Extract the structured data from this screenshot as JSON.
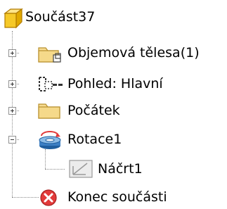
{
  "tree": {
    "root": {
      "label": "Součást37",
      "icon": "part-icon"
    },
    "items": [
      {
        "label": "Objemová tělesa(1)",
        "icon": "solid-bodies-folder-icon",
        "expanded": false
      },
      {
        "label": "Pohled: Hlavní",
        "icon": "view-icon",
        "expanded": false
      },
      {
        "label": "Počátek",
        "icon": "origin-folder-icon",
        "expanded": false
      },
      {
        "label": "Rotace1",
        "icon": "revolve-feature-icon",
        "expanded": true,
        "children": [
          {
            "label": "Náčrt1",
            "icon": "sketch-icon"
          }
        ]
      },
      {
        "label": "Konec součásti",
        "icon": "end-of-part-icon"
      }
    ]
  },
  "colors": {
    "folder": "#f5d98a",
    "part": "#f6c928",
    "revolve": "#3c7fc4",
    "end_marker": "#e23a3a"
  }
}
